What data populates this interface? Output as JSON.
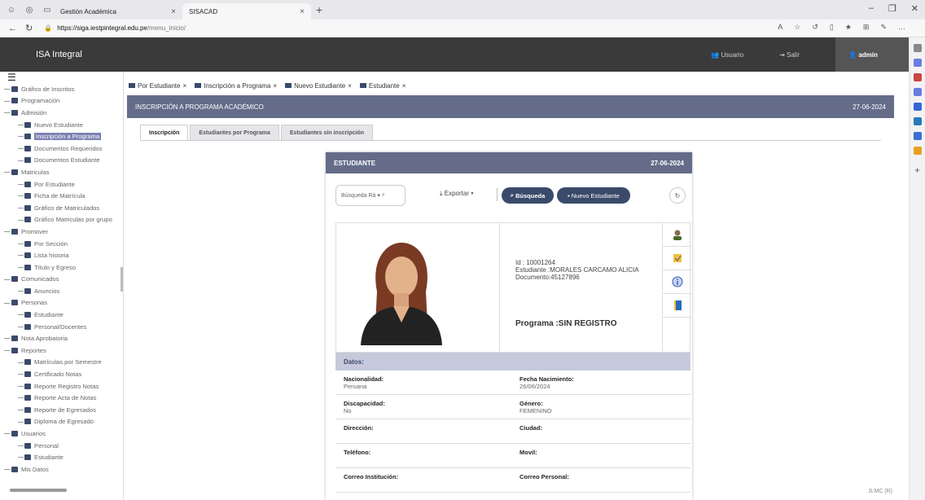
{
  "browser": {
    "tabs": [
      {
        "label": "Gestión Académica"
      },
      {
        "label": "SISACAD"
      }
    ],
    "url_host": "https://siga.iestpintegral.edu.pe",
    "url_path": "/menu_inicio/"
  },
  "header": {
    "brand": "ISA Integral",
    "usuario": "Usuario",
    "salir": "Salir",
    "admin": "admin"
  },
  "sidebar": {
    "items": [
      {
        "label": "Gráfico de Inscritos",
        "level": 0
      },
      {
        "label": "Programación",
        "level": 0
      },
      {
        "label": "Admisión",
        "level": 0
      },
      {
        "label": "Nuevo Estudiante",
        "level": 1
      },
      {
        "label": "Inscripción a Programa",
        "level": 1
      },
      {
        "label": "Documentos Requeridos",
        "level": 1
      },
      {
        "label": "Documentos Estudiante",
        "level": 1
      },
      {
        "label": "Matriculas",
        "level": 0
      },
      {
        "label": "Por Estudiante",
        "level": 1
      },
      {
        "label": "Ficha de Matrícula",
        "level": 1
      },
      {
        "label": "Gráfico de Matriculados",
        "level": 1
      },
      {
        "label": "Gráfico Matriculas por grupo",
        "level": 1
      },
      {
        "label": "Promover",
        "level": 0
      },
      {
        "label": "Por Sección",
        "level": 1
      },
      {
        "label": "Lista historia",
        "level": 1
      },
      {
        "label": "Título y Egreso",
        "level": 1
      },
      {
        "label": "Comunicados",
        "level": 0
      },
      {
        "label": "Anuncios",
        "level": 1
      },
      {
        "label": "Personas",
        "level": 0
      },
      {
        "label": "Estudiante",
        "level": 1
      },
      {
        "label": "Personal/Docentes",
        "level": 1
      },
      {
        "label": "Nota Aprobatoria",
        "level": 0
      },
      {
        "label": "Reportes",
        "level": 0
      },
      {
        "label": "Matrículas por Semestre",
        "level": 1
      },
      {
        "label": "Certificado Notas",
        "level": 1
      },
      {
        "label": "Reporte Registro Notas",
        "level": 1
      },
      {
        "label": "Reporte Acta de Notas",
        "level": 1
      },
      {
        "label": "Reporte de Egresados",
        "level": 1
      },
      {
        "label": "Diploma de Egresado",
        "level": 1
      },
      {
        "label": "Usuarios",
        "level": 0
      },
      {
        "label": "Personal",
        "level": 1
      },
      {
        "label": "Estudiante",
        "level": 1
      },
      {
        "label": "Mis Datos",
        "level": 0
      }
    ]
  },
  "content_tabs": [
    {
      "label": "Por Estudiante"
    },
    {
      "label": "Inscripción a Programa"
    },
    {
      "label": "Nuevo Estudiante"
    },
    {
      "label": "Estudiante"
    }
  ],
  "panel": {
    "title": "INSCRIPCIÓN A PROGRAMA ACADÉMICO",
    "date": "27-06-2024",
    "subtabs": [
      {
        "label": "Inscripción"
      },
      {
        "label": "Estudiantes por Programa"
      },
      {
        "label": "Estudiantes sin inscripción"
      }
    ]
  },
  "card": {
    "title": "ESTUDIANTE",
    "date": "27-06-2024",
    "search_placeholder": "Búsqueda Rá",
    "export_label": "Exportar",
    "busqueda_label": "Búsqueda",
    "nuevo_label": "Nuevo Estudiante",
    "id_line": "Id : 10001264",
    "estudiante_line": "Estudiante :MORALES CARCAMO ALICIA",
    "documento_line": "Documento:45127896",
    "programa_line": "Programa :SIN REGISTRO",
    "datos_title": "Datos:",
    "rows": [
      {
        "l1": "Nacionalidad:",
        "v1": "Peruana",
        "l2": "Fecha Nacimiento:",
        "v2": "26/06/2024"
      },
      {
        "l1": "Discapacidad:",
        "v1": "No",
        "l2": "Género:",
        "v2": "FEMENINO"
      },
      {
        "l1": "Dirección:",
        "v1": "",
        "l2": "Ciudad:",
        "v2": ""
      },
      {
        "l1": "Teléfono:",
        "v1": "",
        "l2": "Movil:",
        "v2": ""
      },
      {
        "l1": "Correo Institución:",
        "v1": "",
        "l2": "Correo Personal:",
        "v2": ""
      }
    ]
  },
  "footer": {
    "text": "JLMC (R)"
  }
}
